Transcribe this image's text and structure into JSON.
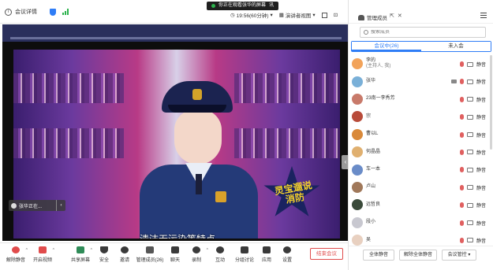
{
  "topbar": {
    "meeting_info_label": "会议详情",
    "info_icon": "info-icon",
    "sharing_notice": "你正在观看张华的屏幕",
    "sharing_suffix": "讯",
    "duration": "19:56(60分钟)",
    "speaker_view": "演讲者视图",
    "colors": {
      "shield": "#2f7df6",
      "signal": "#2bb24c"
    }
  },
  "stage": {
    "subtitle": "清洁无污染等特点",
    "logo_text": "灵宝遛说消防",
    "speaker_chip": "张华正在...",
    "collapse_glyph": "‹"
  },
  "toolbar": {
    "buttons": [
      {
        "label": "解除静音",
        "icon": "mic-off-icon"
      },
      {
        "label": "开启视频",
        "icon": "video-off-icon"
      },
      {
        "label": "共享屏幕",
        "icon": "share-screen-icon"
      },
      {
        "label": "安全",
        "icon": "shield-icon"
      },
      {
        "label": "邀请",
        "icon": "invite-icon"
      },
      {
        "label": "管理成员(26)",
        "icon": "members-icon"
      },
      {
        "label": "聊天",
        "icon": "chat-icon"
      },
      {
        "label": "录制",
        "icon": "record-icon"
      },
      {
        "label": "互动",
        "icon": "emoji-icon"
      },
      {
        "label": "分组讨论",
        "icon": "breakout-icon"
      },
      {
        "label": "应用",
        "icon": "apps-icon"
      },
      {
        "label": "设置",
        "icon": "settings-icon"
      }
    ],
    "end_meeting": "结束会议",
    "end_color": "#e04b4b"
  },
  "panel": {
    "title": "管理成员",
    "search_placeholder": "搜索成员",
    "tabs": [
      "会议中(26)",
      "未入会"
    ],
    "members": [
      {
        "name": "李的",
        "sub": "(主持人, 我)",
        "avatar_color": "#f2a35a",
        "action": "静音"
      },
      {
        "name": "张华",
        "sub": "",
        "avatar_color": "#7ab0d8",
        "action": "静音"
      },
      {
        "name": "23南一李秀芳",
        "sub": "",
        "avatar_color": "#c87a6a",
        "action": "静音"
      },
      {
        "name": "宗",
        "sub": "",
        "avatar_color": "#b84b3a",
        "action": "静音"
      },
      {
        "name": "曹以L",
        "sub": "",
        "avatar_color": "#d9893a",
        "action": "静音"
      },
      {
        "name": "何晶晶",
        "sub": "",
        "avatar_color": "#e0b070",
        "action": "静音"
      },
      {
        "name": "车一本",
        "sub": "",
        "avatar_color": "#6a8cc8",
        "action": "静音"
      },
      {
        "name": "卢山",
        "sub": "",
        "avatar_color": "#a0785a",
        "action": "静音"
      },
      {
        "name": "远哲良",
        "sub": "",
        "avatar_color": "#3a4a3a",
        "action": "静音"
      },
      {
        "name": "段小",
        "sub": "",
        "avatar_color": "#c8c8d0",
        "action": "静音"
      },
      {
        "name": "吴",
        "sub": "",
        "avatar_color": "#e8d0c0",
        "action": "静音"
      }
    ],
    "footer": {
      "mute_all": "全体静音",
      "unmute_all": "解除全体静音",
      "controls": "会议管控 ▾"
    }
  }
}
